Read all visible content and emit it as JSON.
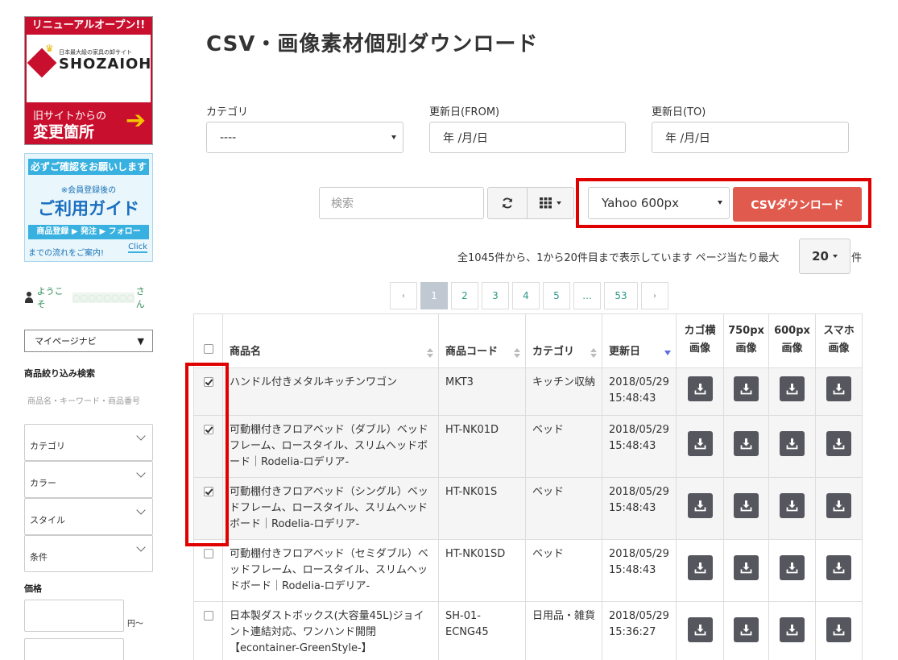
{
  "sidebar": {
    "banner1": {
      "top": "リニューアルオープン!!",
      "tagline": "日本最大級の家具の卸サイト",
      "brand": "SHOZAIOH",
      "line1": "旧サイトからの",
      "line2": "変更箇所",
      "arrow": "➔"
    },
    "banner2": {
      "top": "必ずご確認をお願いします",
      "note": "※会員登録後の",
      "main": "ご利用ガイド",
      "steps": "商品登録 ▶ 発注 ▶ フォロー",
      "foot": "までの流れをご案内!",
      "click": "Click"
    },
    "welcome_prefix": "ようこそ",
    "welcome_name": "○○○○○○○○",
    "welcome_suffix": "さん",
    "mypage": "マイページナビ",
    "mypage_caret": "▼",
    "search_heading": "商品絞り込み検索",
    "search_hint": "商品名・キーワード・商品番号",
    "filters": [
      "カテゴリ",
      "カラー",
      "スタイル",
      "条件"
    ],
    "price_heading": "価格",
    "price_unit": "円～"
  },
  "main": {
    "title": "CSV・画像素材個別ダウンロード",
    "category_label": "カテゴリ",
    "category_value": "----",
    "from_label": "更新日(FROM)",
    "from_value": "年 /月/日",
    "to_label": "更新日(TO)",
    "to_value": "年 /月/日",
    "search_placeholder": "検索",
    "preset_value": "Yahoo 600px",
    "csv_button": "CSVダウンロード",
    "summary": "全1045件から、1から20件目まで表示しています ページ当たり最大",
    "per_page": "20",
    "per_page_unit": "件",
    "pager": [
      "‹",
      "1",
      "2",
      "3",
      "4",
      "5",
      "...",
      "53",
      "›"
    ]
  },
  "table": {
    "headers": {
      "name": "商品名",
      "code": "商品コード",
      "category": "カテゴリ",
      "updated": "更新日",
      "img1a": "カゴ横",
      "img1b": "画像",
      "img2a": "750px",
      "img2b": "画像",
      "img3a": "600px",
      "img3b": "画像",
      "img4a": "スマホ",
      "img4b": "画像"
    },
    "rows": [
      {
        "name": "ハンドル付きメタルキッチンワゴン",
        "code": "MKT3",
        "category": "キッチン収納",
        "date": "2018/05/29",
        "time": "15:48:43"
      },
      {
        "name": "可動棚付きフロアベッド（ダブル）ベッドフレーム、ロースタイル、スリムヘッドボード｜Rodelia-ロデリア-",
        "code": "HT-NK01D",
        "category": "ベッド",
        "date": "2018/05/29",
        "time": "15:48:43"
      },
      {
        "name": "可動棚付きフロアベッド（シングル）ベッドフレーム、ロースタイル、スリムヘッドボード｜Rodelia-ロデリア-",
        "code": "HT-NK01S",
        "category": "ベッド",
        "date": "2018/05/29",
        "time": "15:48:43"
      },
      {
        "name": "可動棚付きフロアベッド（セミダブル）ベッドフレーム、ロースタイル、スリムヘッドボード｜Rodelia-ロデリア-",
        "code": "HT-NK01SD",
        "category": "ベッド",
        "date": "2018/05/29",
        "time": "15:48:43"
      },
      {
        "name": "日本製ダストボックス(大容量45L)ジョイント連結対応、ワンハンド開閉【econtainer-GreenStyle-】",
        "code": "SH-01-ECNG45",
        "category": "日用品・雑貨",
        "date": "2018/05/29",
        "time": "15:36:27"
      }
    ]
  }
}
